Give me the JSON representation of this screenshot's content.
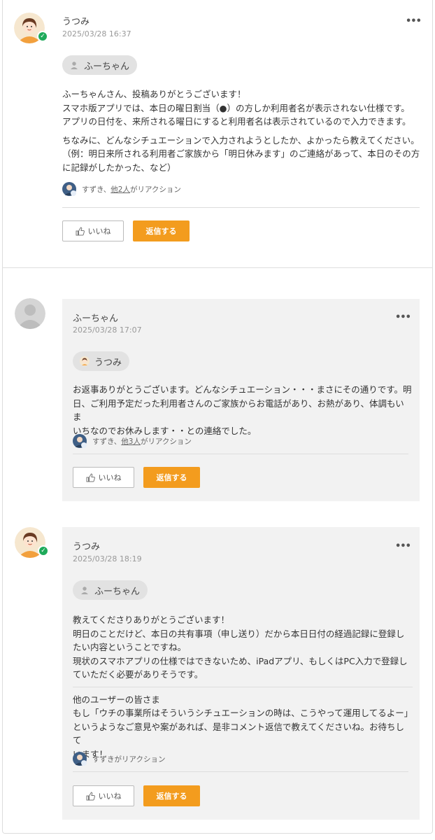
{
  "colors": {
    "accent": "#f39c1e",
    "verified": "#1eaa5a",
    "reply_bg": "#f2f2f2"
  },
  "posts": [
    {
      "author": "うつみ",
      "date": "2025/03/28 16:37",
      "mention": "ふーちゃん",
      "lines": [
        "ふーちゃんさん、投稿ありがとうございます！",
        "スマホ版アプリでは、本日の曜日割当（●）の方しか利用者名が表示されない仕様です。",
        "アプリの日付を、来所される曜日にすると利用者名は表示されているので入力できます。",
        "",
        "ちなみに、どんなシチュエーションで入力されようとしたか、よかったら教えてください。",
        "（例：明日来所される利用者ご家族から「明日休みます」のご連絡があって、本日のその方",
        "に記録がしたかった、など）"
      ],
      "reaction_prefix": "すずき、",
      "reaction_link": "他2人",
      "reaction_suffix": " がリアクション",
      "like_label": "いいね",
      "reply_label": "返信する"
    },
    {
      "author": "ふーちゃん",
      "date": "2025/03/28 17:07",
      "mention": "うつみ",
      "lines": [
        "お返事ありがとうございます。どんなシチュエーション・・・まさにその通りです。明",
        "日、ご利用予定だった利用者さんのご家族からお電話があり、お熱があり、体調もいま",
        "いちなのでお休みします・・との連絡でした。"
      ],
      "reaction_prefix": "すずき、",
      "reaction_link": "他3人",
      "reaction_suffix": " がリアクション",
      "like_label": "いいね",
      "reply_label": "返信する"
    },
    {
      "author": "うつみ",
      "date": "2025/03/28 18:19",
      "mention": "ふーちゃん",
      "lines": [
        "教えてくださりありがとうございます！",
        "明日のことだけど、本日の共有事項（申し送り）だから本日日付の経過記録に登録し",
        "たい内容ということですね。",
        "現状のスマホアプリの仕様ではできないため、iPadアプリ、もしくはPC入力で登録し",
        "ていただく必要がありそうです。",
        "---",
        "他のユーザーの皆さま",
        "もし「ウチの事業所はそういうシチュエーションの時は、こうやって運用してるよー」",
        "というようなご意見や案があれば、是非コメント返信で教えてくださいね。お待ちして",
        "います！"
      ],
      "reaction_prefix": "すずき",
      "reaction_link": "",
      "reaction_suffix": " がリアクション",
      "like_label": "いいね",
      "reply_label": "返信する"
    }
  ]
}
